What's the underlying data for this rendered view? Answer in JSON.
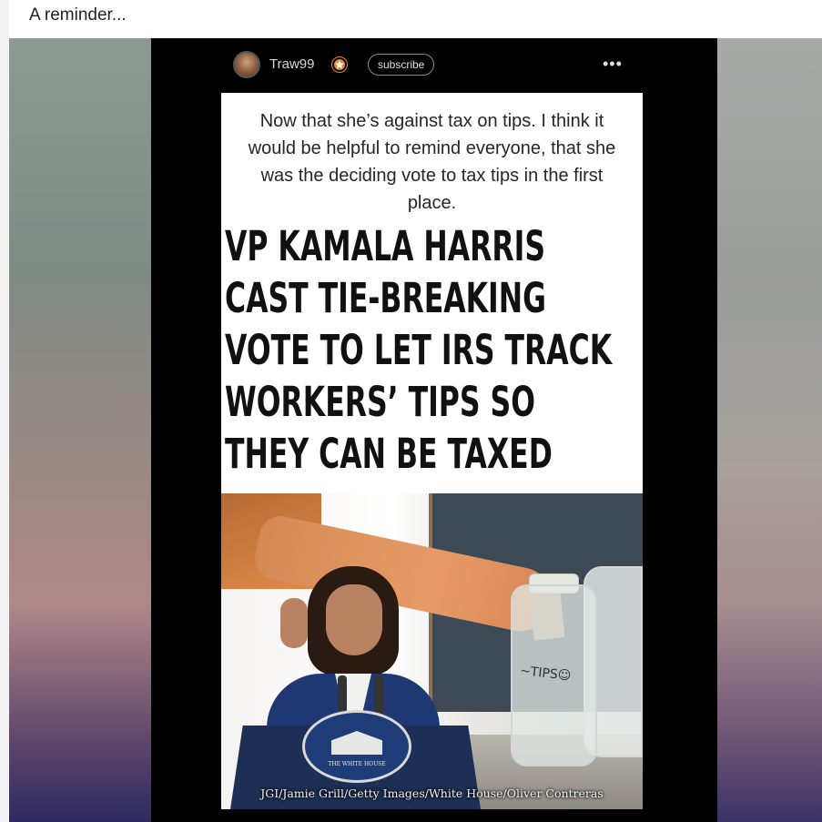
{
  "caption": {
    "text": "A reminder..."
  },
  "post": {
    "username": "Traw99",
    "badge_icon": "star-badge-icon",
    "subscribe_label": "subscribe",
    "more_icon_label": "•••"
  },
  "meme": {
    "quote": "Now that she’s against tax on tips. I think it would be helpful to remind everyone, that she was the deciding vote to tax tips in the first place.",
    "headline_lines": [
      "VP KAMALA HARRIS",
      "CAST TIE-BREAKING",
      "VOTE TO LET IRS TRACK",
      "WORKERS’ TIPS SO",
      "THEY CAN BE TAXED"
    ],
    "jar_label": "~TIPS☺",
    "seal_text": "THE WHITE HOUSE",
    "photo_credit": "JGI/Jamie Grill/Getty Images/White House/Oliver Contreras"
  },
  "colors": {
    "post_background": "#000000",
    "badge": "#e08a2c",
    "jacket": "#1f3874"
  }
}
